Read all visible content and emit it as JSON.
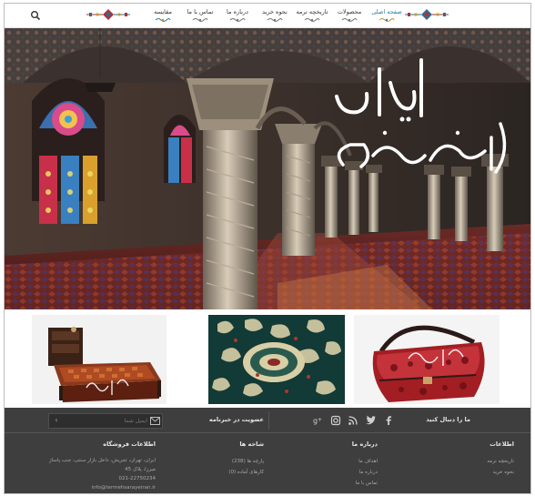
{
  "header": {
    "search_icon": "search-icon",
    "nav": [
      {
        "label": "صفحه اصلی",
        "active": true
      },
      {
        "label": "محصولات",
        "active": false
      },
      {
        "label": "تاریخچه ترمه",
        "active": false
      },
      {
        "label": "نحوه خرید",
        "active": false
      },
      {
        "label": "درباره ما",
        "active": false
      },
      {
        "label": "تماس با ما",
        "active": false
      },
      {
        "label": "مقایسه",
        "active": false
      }
    ]
  },
  "hero": {
    "logo_alt": "ایران ترمه سرای"
  },
  "products": [
    {
      "name": "bed",
      "watermark": "ترمه سرای ایران"
    },
    {
      "name": "cloth",
      "watermark": ""
    },
    {
      "name": "bag",
      "watermark": "ترمه سرای ایران"
    }
  ],
  "footer": {
    "social_label": "ما را دنبال کنید",
    "newsletter_label": "عضویت در خبرنامه",
    "newsletter_placeholder": "ایمیل شما",
    "social_icons": [
      "facebook-icon",
      "twitter-icon",
      "instagram-icon",
      "rss-icon",
      "google-plus-icon"
    ],
    "columns": {
      "info": {
        "title": "اطلاعات",
        "links": [
          "تاریخچه ترمه",
          "نحوه خرید"
        ]
      },
      "about": {
        "title": "درباره ما",
        "links": [
          "اهداف ما",
          "درباره ما",
          "تماس با ما"
        ]
      },
      "branches": {
        "title": "شاخه ها",
        "links": [
          "پارچه ها (238)",
          "کارهای آماده (0)"
        ]
      },
      "store": {
        "title": "اطلاعات فروشگاه",
        "lines": [
          "ایران، تهران، تجریش، داخل بازار سنتی، جنب پاساژ",
          "میرزا، پلاک 45",
          "021-22750234",
          "info@termehsarayeiran.ir"
        ]
      }
    }
  },
  "colors": {
    "footer_bg": "#3e3e3e",
    "accent": "#2a7fa0"
  }
}
